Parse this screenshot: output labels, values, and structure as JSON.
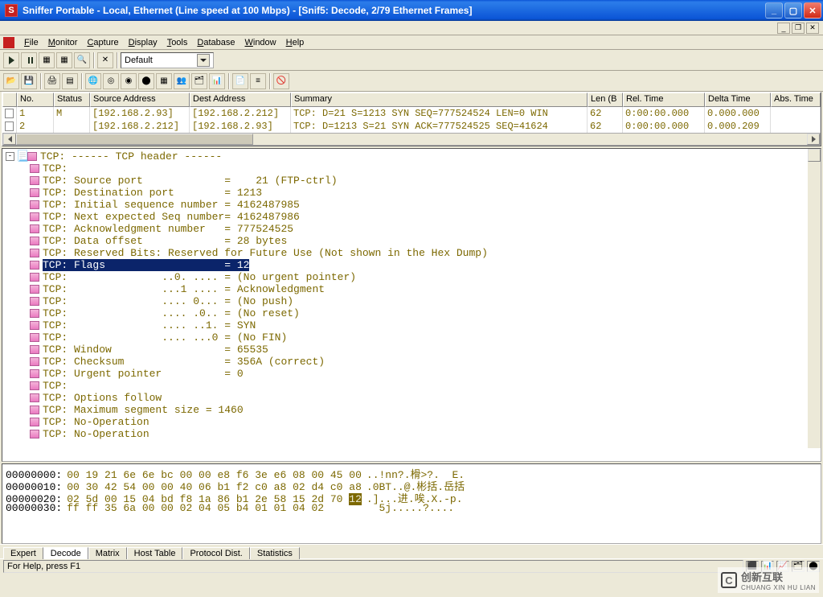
{
  "title": "Sniffer Portable - Local, Ethernet (Line speed at 100 Mbps) - [Snif5: Decode, 2/79 Ethernet Frames]",
  "app_letter": "S",
  "menu": [
    {
      "label": "File",
      "ul": "F"
    },
    {
      "label": "Monitor",
      "ul": "M"
    },
    {
      "label": "Capture",
      "ul": "C"
    },
    {
      "label": "Display",
      "ul": "D"
    },
    {
      "label": "Tools",
      "ul": "T"
    },
    {
      "label": "Database",
      "ul": "D"
    },
    {
      "label": "Window",
      "ul": "W"
    },
    {
      "label": "Help",
      "ul": "H"
    }
  ],
  "combo_default": "Default",
  "grid_headers": [
    "",
    "No.",
    "Status",
    "Source Address",
    "Dest Address",
    "Summary",
    "Len (B",
    "Rel. Time",
    "Delta Time",
    "Abs. Time"
  ],
  "grid_rows": [
    {
      "no": "1",
      "status": "M",
      "src": "[192.168.2.93]",
      "dst": "[192.168.2.212]",
      "summary": "TCP: D=21 S=1213 SYN SEQ=777524524 LEN=0 WIN",
      "len": "62",
      "rel": "0:00:00.000",
      "delta": "0.000.000",
      "abs": ""
    },
    {
      "no": "2",
      "status": "",
      "src": "[192.168.2.212]",
      "dst": "[192.168.2.93]",
      "summary": "TCP: D=1213 S=21 SYN ACK=777524525 SEQ=41624",
      "len": "62",
      "rel": "0:00:00.000",
      "delta": "0.000.209",
      "abs": ""
    }
  ],
  "decode": [
    {
      "lvl": 0,
      "toggle": "-",
      "text": "TCP: ------ TCP header ------"
    },
    {
      "lvl": 1,
      "text": "TCP:"
    },
    {
      "lvl": 1,
      "text": "TCP: Source port             =    21 (FTP-ctrl)"
    },
    {
      "lvl": 1,
      "text": "TCP: Destination port        = 1213"
    },
    {
      "lvl": 1,
      "text": "TCP: Initial sequence number = 4162487985"
    },
    {
      "lvl": 1,
      "text": "TCP: Next expected Seq number= 4162487986"
    },
    {
      "lvl": 1,
      "text": "TCP: Acknowledgment number   = 777524525"
    },
    {
      "lvl": 1,
      "text": "TCP: Data offset             = 28 bytes"
    },
    {
      "lvl": 1,
      "text": "TCP: Reserved Bits: Reserved for Future Use (Not shown in the Hex Dump)"
    },
    {
      "lvl": 1,
      "sel": true,
      "text": "TCP: Flags                   = 12"
    },
    {
      "lvl": 1,
      "text": "TCP:               ..0. .... = (No urgent pointer)"
    },
    {
      "lvl": 1,
      "text": "TCP:               ...1 .... = Acknowledgment"
    },
    {
      "lvl": 1,
      "text": "TCP:               .... 0... = (No push)"
    },
    {
      "lvl": 1,
      "text": "TCP:               .... .0.. = (No reset)"
    },
    {
      "lvl": 1,
      "text": "TCP:               .... ..1. = SYN"
    },
    {
      "lvl": 1,
      "text": "TCP:               .... ...0 = (No FIN)"
    },
    {
      "lvl": 1,
      "text": "TCP: Window                  = 65535"
    },
    {
      "lvl": 1,
      "text": "TCP: Checksum                = 356A (correct)"
    },
    {
      "lvl": 1,
      "text": "TCP: Urgent pointer          = 0"
    },
    {
      "lvl": 1,
      "text": "TCP:"
    },
    {
      "lvl": 1,
      "text": "TCP: Options follow"
    },
    {
      "lvl": 1,
      "text": "TCP: Maximum segment size = 1460"
    },
    {
      "lvl": 1,
      "text": "TCP: No-Operation"
    },
    {
      "lvl": 1,
      "text": "TCP: No-Operation"
    }
  ],
  "hex": [
    {
      "addr": "00000000:",
      "bytes": "00 19 21 6e 6e bc 00 00 e8 f6 3e e6 08 00 45 00",
      "ascii": "..!nn?.榾>?.  E."
    },
    {
      "addr": "00000010:",
      "bytes": "00 30 42 54 00 00 40 06 b1 f2 c0 a8 02 d4 c0 a8",
      "ascii": ".0BT..@.彬括.岳括"
    },
    {
      "addr": "00000020:",
      "bytes": "02 5d 00 15 04 bd f8 1a 86 b1 2e 58 15 2d 70 ",
      "hl": "12",
      "ascii": ".]...进.唉.X.-p."
    },
    {
      "addr": "00000030:",
      "bytes": "ff ff 35 6a 00 00 02 04 05 b4 01 01 04 02      ",
      "ascii": "  5j.....?...."
    }
  ],
  "tabs": [
    "Expert",
    "Decode",
    "Matrix",
    "Host Table",
    "Protocol Dist.",
    "Statistics"
  ],
  "active_tab": 1,
  "status": "For Help, press F1",
  "watermark": "创新互联",
  "watermark_sub": "CHUANG XIN HU LIAN"
}
